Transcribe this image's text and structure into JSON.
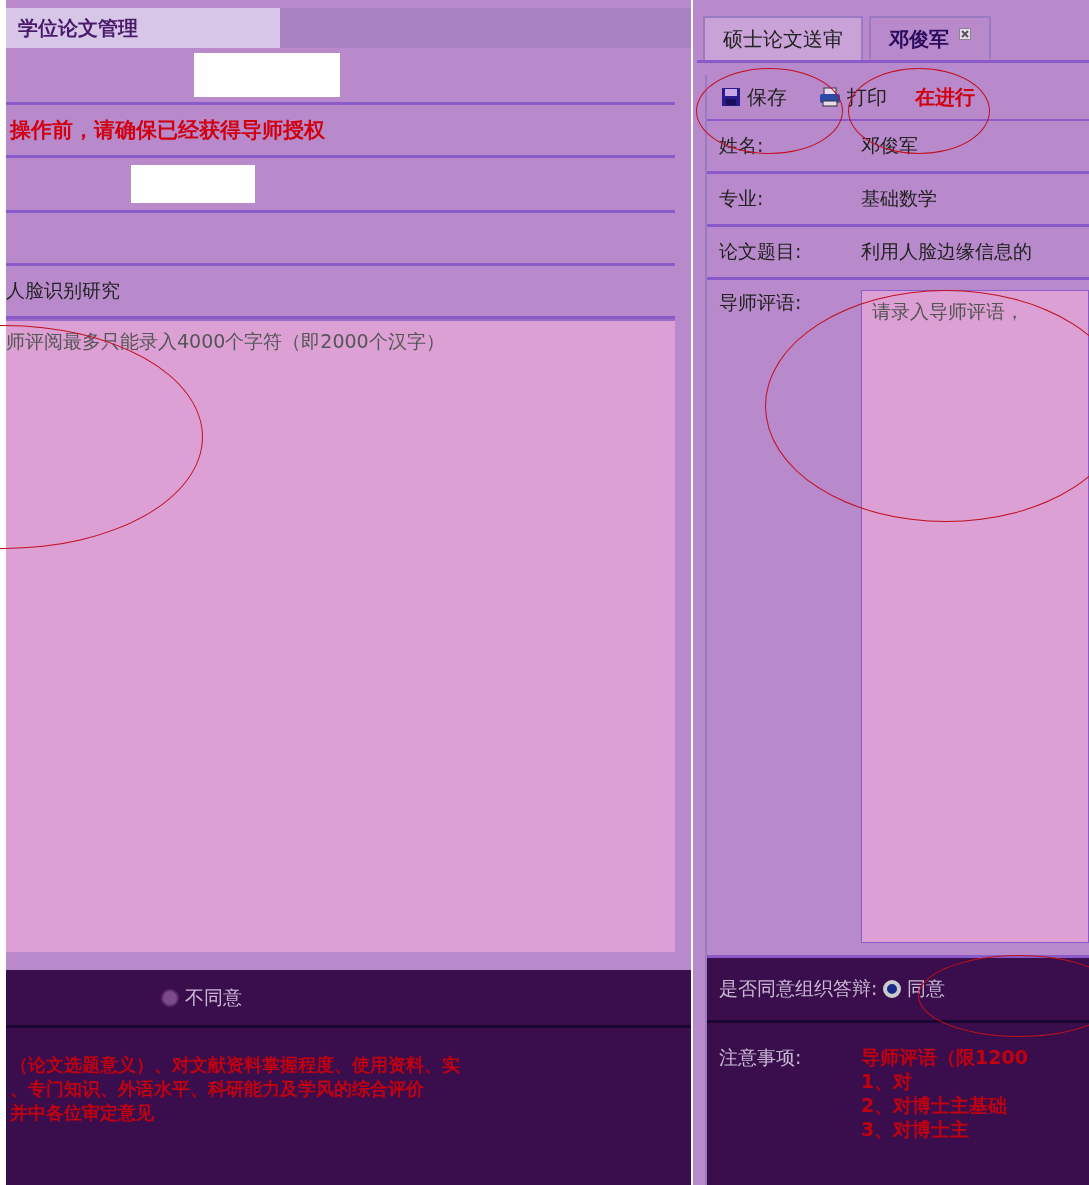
{
  "left_panel": {
    "title": "学位论文管理",
    "warning": "操作前，请确保已经获得导师授权",
    "topic": "人脸识别研究",
    "comment_placeholder": "师评阅最多只能录入4000个字符（即2000个汉字）",
    "options": [
      {
        "label": "不同意",
        "selected": false
      }
    ],
    "notes": [
      "（论文选题意义）、对文献资料掌握程度、使用资料、实",
      "、专门知识、外语水平、科研能力及学风的综合评价",
      "并中各位审定意见"
    ]
  },
  "right_panel": {
    "tabs": [
      {
        "label": "硕士论文送审",
        "selected": false,
        "closable": false
      },
      {
        "label": "邓俊军",
        "selected": true,
        "closable": true
      }
    ],
    "toolbar": [
      {
        "kind": "save",
        "label": "保存"
      },
      {
        "kind": "print",
        "label": "打印"
      }
    ],
    "toolbar_warning": "在进行",
    "fields": [
      {
        "label": "姓名:",
        "value": "邓俊军"
      },
      {
        "label": "专业:",
        "value": "基础数学"
      },
      {
        "label": "论文题目:",
        "value": "利用人脸边缘信息的"
      }
    ],
    "comment_label": "导师评语:",
    "comment_placeholder": "请录入导师评语，",
    "agree_label": "是否同意组织答辩:",
    "options": [
      {
        "label": "同意",
        "selected": true
      }
    ],
    "notes_label": "注意事项:",
    "notes": [
      "导师评语（限1200",
      "1、对",
      "2、对博士主基础",
      "3、对博士主"
    ]
  }
}
